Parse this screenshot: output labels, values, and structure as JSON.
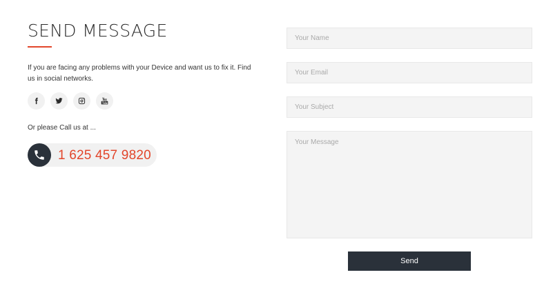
{
  "contact": {
    "title": "SEND MESSAGE",
    "description": "If you are facing any problems with your Device and want us to fix it. Find us in social networks.",
    "call_prompt": "Or please Call us at ...",
    "phone": "1 625 457 9820"
  },
  "social_icons": [
    "facebook-icon",
    "twitter-icon",
    "instagram-icon",
    "youtube-icon"
  ],
  "form": {
    "name_placeholder": "Your Name",
    "email_placeholder": "Your Email",
    "subject_placeholder": "Your Subject",
    "message_placeholder": "Your Message",
    "send_label": "Send"
  },
  "colors": {
    "accent": "#e2452a",
    "dark": "#2a313a",
    "field_bg": "#f4f4f4"
  }
}
